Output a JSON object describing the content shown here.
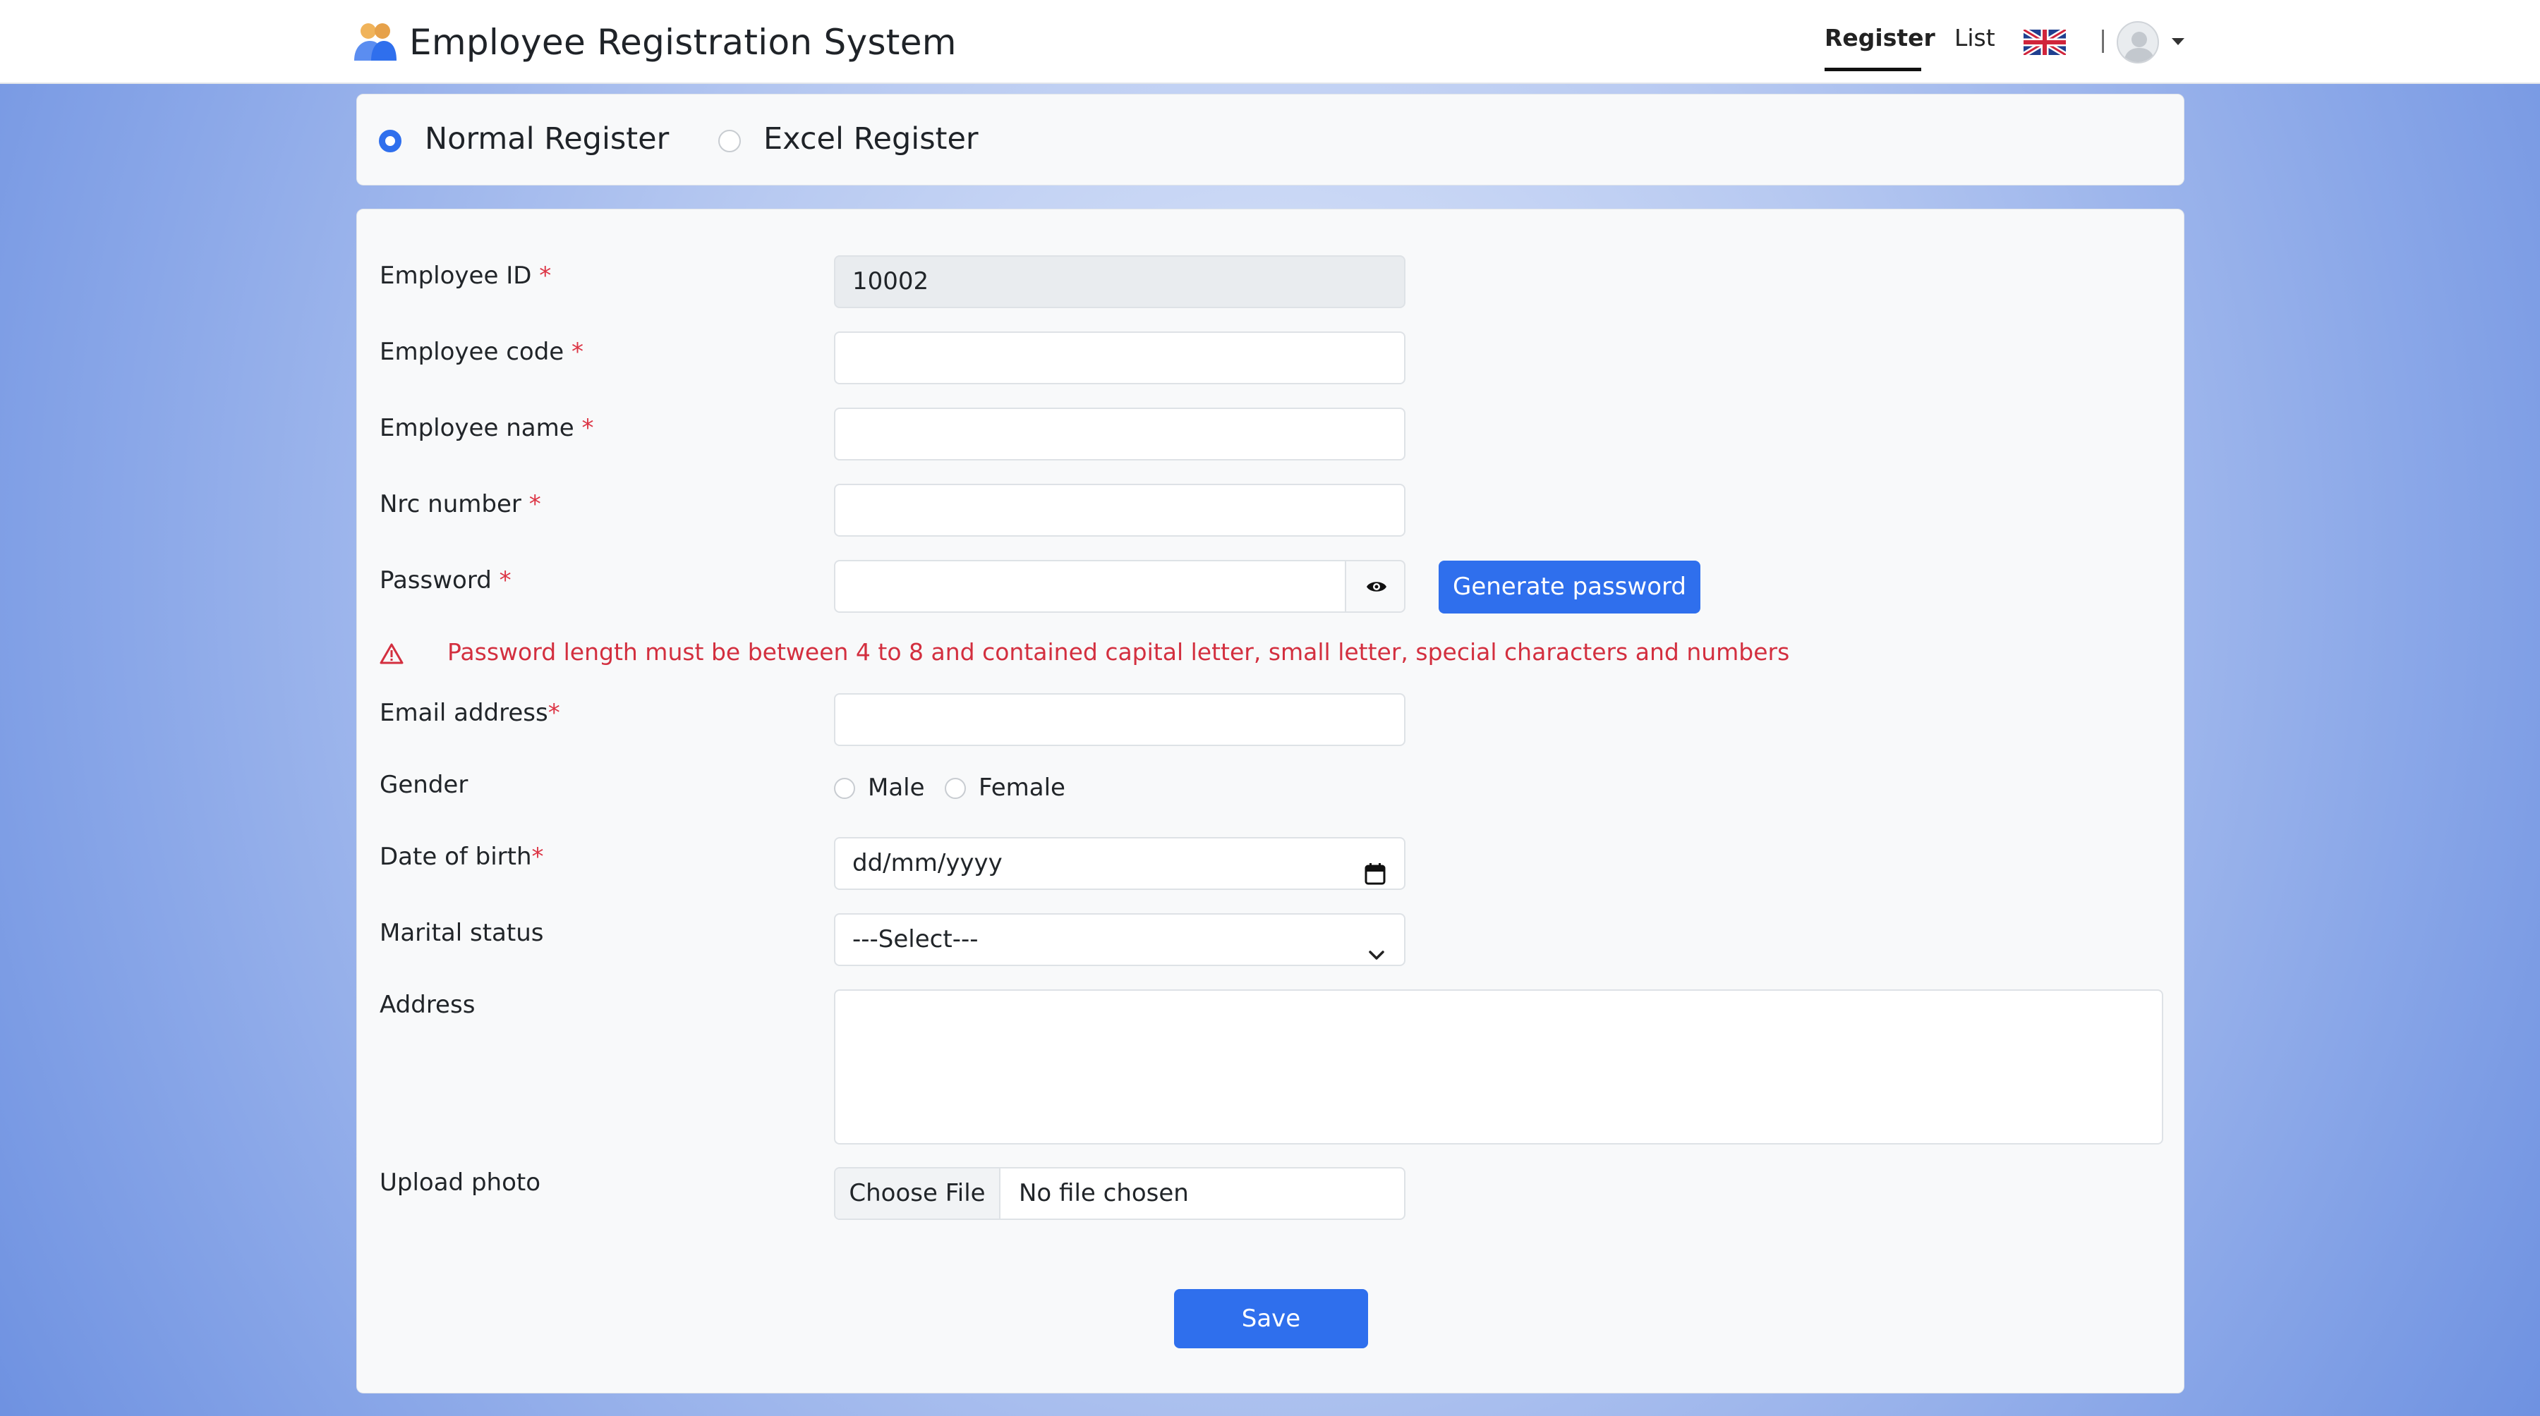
{
  "app": {
    "title": "Employee Registration System"
  },
  "nav": {
    "register": "Register",
    "list": "List",
    "divider": "|"
  },
  "register_type": {
    "normal": "Normal Register",
    "excel": "Excel Register",
    "selected": "Normal Register"
  },
  "form": {
    "employee_id": {
      "label": "Employee ID",
      "required": "*",
      "value": "10002"
    },
    "employee_code": {
      "label": "Employee code",
      "required": "*",
      "value": ""
    },
    "employee_name": {
      "label": "Employee name",
      "required": "*",
      "value": ""
    },
    "nrc_number": {
      "label": "Nrc number",
      "required": "*",
      "value": ""
    },
    "password": {
      "label": "Password",
      "required": "*",
      "value": "",
      "generate_label": "Generate password"
    },
    "password_warning": "Password length must be between 4 to 8 and contained capital letter, small letter, special characters and numbers",
    "email": {
      "label": "Email address",
      "required": "*",
      "value": ""
    },
    "gender": {
      "label": "Gender",
      "options": [
        "Male",
        "Female"
      ]
    },
    "dob": {
      "label": "Date of birth",
      "required": "*",
      "placeholder": "dd/mm/yyyy"
    },
    "marital_status": {
      "label": "Marital status",
      "selected": "---Select---"
    },
    "address": {
      "label": "Address",
      "value": ""
    },
    "upload_photo": {
      "label": "Upload photo",
      "button": "Choose File",
      "status": "No file chosen"
    },
    "save_label": "Save"
  },
  "colors": {
    "primary": "#2f6fed",
    "danger": "#d32f3f",
    "readonly_bg": "#e9ecef"
  },
  "icons": {
    "brand": "people-icon",
    "language": "uk-flag-icon",
    "user": "user-avatar-icon",
    "password_toggle": "eye-icon",
    "warning": "warning-triangle-icon",
    "calendar": "calendar-icon",
    "select": "chevron-down-icon"
  }
}
